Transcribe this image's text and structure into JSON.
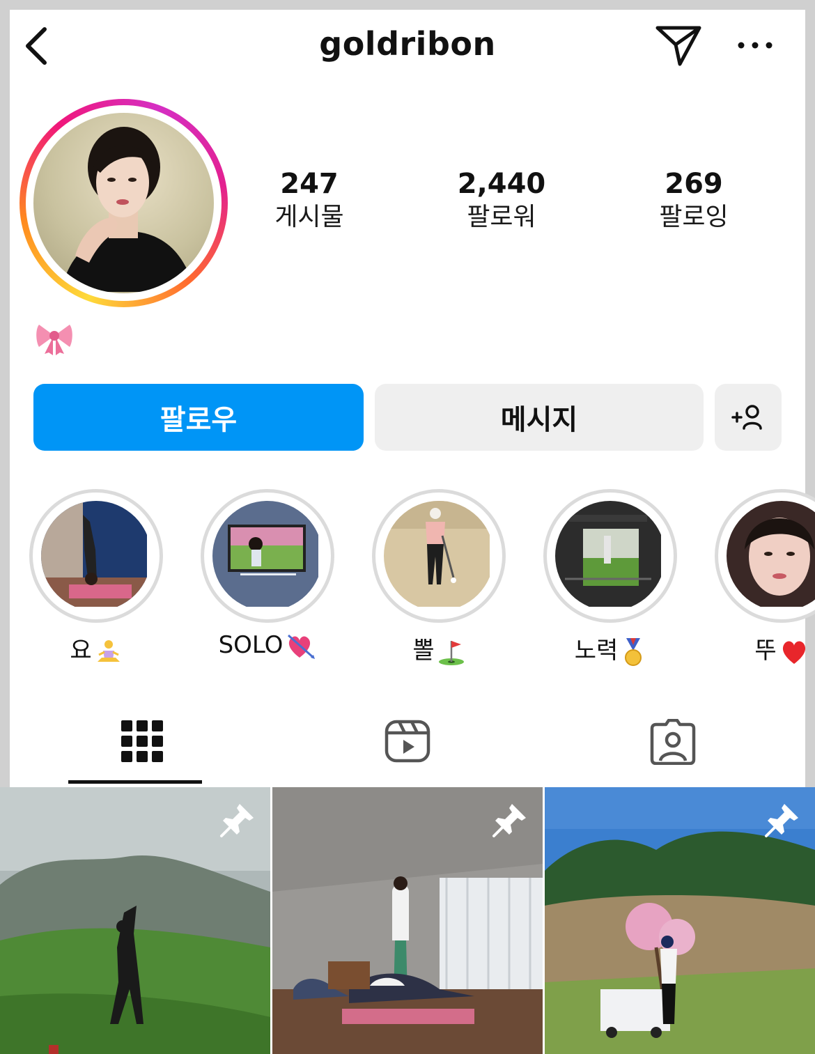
{
  "header": {
    "username": "goldribon",
    "icons": [
      "back-chevron-icon",
      "paper-plane-send-icon",
      "more-ellipsis-icon"
    ]
  },
  "profile": {
    "stats": [
      {
        "value": "247",
        "label": "게시물"
      },
      {
        "value": "2,440",
        "label": "팔로워"
      },
      {
        "value": "269",
        "label": "팔로잉"
      }
    ],
    "bio_icon": "ribbon-bow-emoji",
    "story_ring_colors": [
      "#feda3a",
      "#ff8a1e",
      "#f0177a",
      "#d52fc3"
    ]
  },
  "actions": {
    "follow_label": "팔로우",
    "message_label": "메시지",
    "add_user_icon": "add-person-icon",
    "follow_color": "#0095f6",
    "secondary_bg": "#efefef"
  },
  "highlights": [
    {
      "label": "요",
      "emoji": "meditation-person-emoji"
    },
    {
      "label": "SOLO",
      "emoji": "heart-with-arrow-emoji"
    },
    {
      "label": "뽈",
      "emoji": "golf-flag-emoji"
    },
    {
      "label": "노력",
      "emoji": "medal-emoji"
    },
    {
      "label": "뚜",
      "emoji": "red-heart-emoji"
    }
  ],
  "tabs": [
    {
      "name": "grid-tab",
      "icon": "grid-icon",
      "active": true
    },
    {
      "name": "reels-tab",
      "icon": "reels-icon",
      "active": false
    },
    {
      "name": "tagged-tab",
      "icon": "tagged-person-icon",
      "active": false
    }
  ],
  "posts": [
    {
      "pinned": true,
      "icon": "pin-icon"
    },
    {
      "pinned": true,
      "icon": "pin-icon"
    },
    {
      "pinned": true,
      "icon": "pin-icon"
    }
  ]
}
